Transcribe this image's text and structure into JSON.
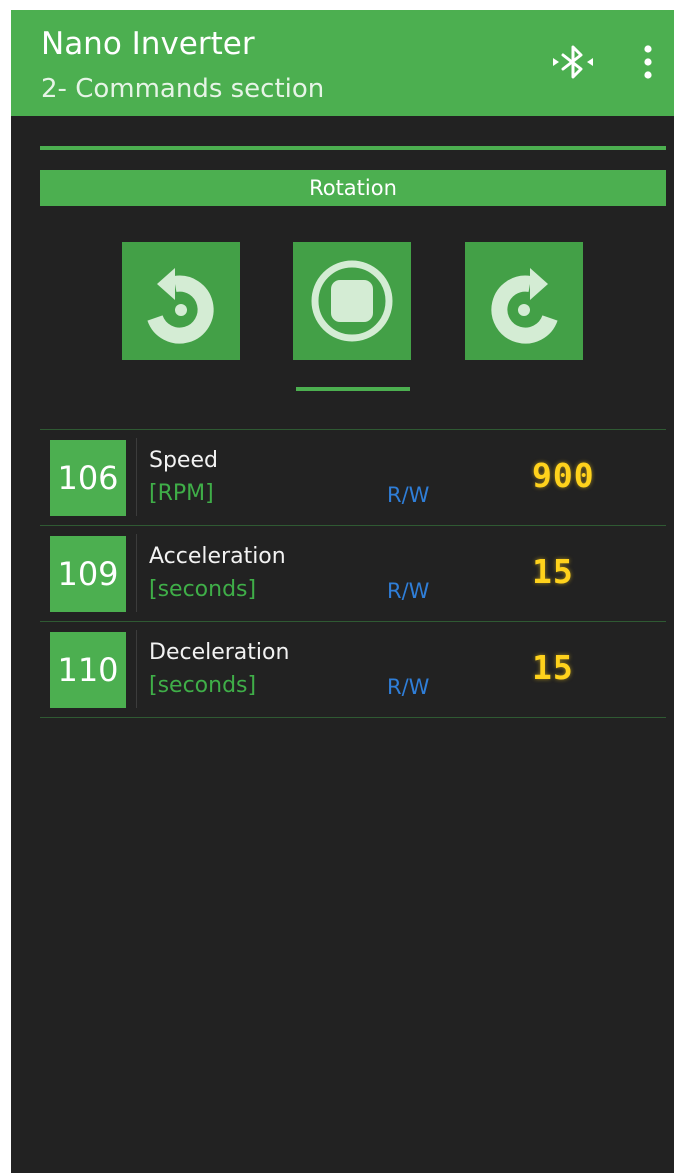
{
  "app": {
    "title": "Nano Inverter",
    "subtitle": "2- Commands section"
  },
  "toolbar": {
    "bluetooth_icon": "bluetooth-searching-icon",
    "menu_icon": "more-vertical-icon"
  },
  "rotation": {
    "label": "Rotation",
    "buttons": [
      {
        "name": "rotate-counterclockwise",
        "icon": "rotate-ccw-icon"
      },
      {
        "name": "stop",
        "icon": "stop-icon"
      },
      {
        "name": "rotate-clockwise",
        "icon": "rotate-cw-icon"
      }
    ]
  },
  "parameters": [
    {
      "id": "106",
      "name": "Speed",
      "unit": "[RPM]",
      "access": "R/W",
      "value": "900"
    },
    {
      "id": "109",
      "name": "Acceleration",
      "unit": "[seconds]",
      "access": "R/W",
      "value": "15"
    },
    {
      "id": "110",
      "name": "Deceleration",
      "unit": "[seconds]",
      "access": "R/W",
      "value": "15"
    }
  ],
  "colors": {
    "accent": "#4caf50",
    "background": "#222222",
    "value_text": "#ffd21c",
    "access_text": "#2f7ed8",
    "unit_text": "#3fae48"
  }
}
